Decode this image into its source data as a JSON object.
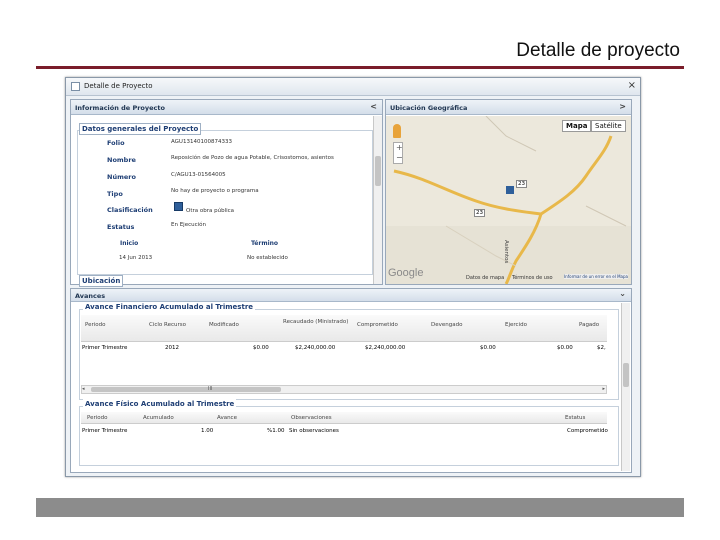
{
  "slide": {
    "title": "Detalle de proyecto"
  },
  "window": {
    "title": "Detalle de Proyecto",
    "close": "×"
  },
  "info": {
    "header": "Información de Proyecto",
    "collapse": "<",
    "legend": "Datos generales del Proyecto",
    "fields": [
      {
        "label": "Folio",
        "value": "AGU13140100874333"
      },
      {
        "label": "Nombre",
        "value": "Reposición de Pozo de agua Potable, Crisostomos, asientos"
      },
      {
        "label": "Número",
        "value": "C/AGU13-01564005"
      },
      {
        "label": "Tipo",
        "value": ""
      },
      {
        "label": "Clasificación",
        "value": "Otra obra pública"
      },
      {
        "label": "Estatus",
        "value": "En Ejecución"
      }
    ],
    "tipo_value": "No hay de proyecto o programa",
    "inicio_label": "Inicio",
    "inicio_value": "14 Jun 2013",
    "termino_label": "Término",
    "termino_value": "No establecido",
    "ubicacion_tab": "Ubicación"
  },
  "map": {
    "header": "Ubicación Geográfica",
    "expand": ">",
    "btn_mapa": "Mapa",
    "btn_satelite": "Satélite",
    "zoom_in": "+",
    "zoom_out": "−",
    "google": "Google",
    "footer1": "Datos de mapa",
    "footer2": "Términos de uso",
    "footer3": "Informar de un error en el Mapa",
    "road1": "23",
    "road2": "23",
    "place": "Asientos"
  },
  "avances": {
    "header": "Avances",
    "expand": "⌄",
    "fin": {
      "legend": "Avance Financiero Acumulado al Trimestre",
      "columns": [
        "Periodo",
        "Ciclo Recurso",
        "Modificado",
        "Recaudado (Ministrado)",
        "Comprometido",
        "Devengado",
        "Ejercido",
        "Pagado"
      ],
      "rows": [
        [
          "Primer Trimestre",
          "2012",
          "$0.00",
          "$2,240,000.00",
          "$2,240,000.00",
          "$0.00",
          "$0.00",
          "$2,"
        ]
      ],
      "hscroll": "III"
    },
    "fis": {
      "legend": "Avance Físico Acumulado al Trimestre",
      "columns": [
        "Periodo",
        "Acumulado",
        "Avance",
        "Observaciones",
        "Estatus"
      ],
      "rows": [
        [
          "Primer Trimestre",
          "1.00",
          "%1.00",
          "Sin observaciones",
          "Comprometido"
        ]
      ]
    }
  }
}
